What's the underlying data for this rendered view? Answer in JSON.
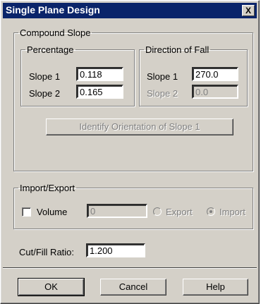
{
  "window": {
    "title": "Single Plane Design",
    "close_glyph": "X"
  },
  "compound_slope": {
    "legend": "Compound Slope",
    "percentage": {
      "legend": "Percentage",
      "slope1_label": "Slope 1",
      "slope1_value": "0.118",
      "slope2_label": "Slope 2",
      "slope2_value": "0.165"
    },
    "direction": {
      "legend": "Direction of Fall",
      "slope1_label": "Slope 1",
      "slope1_value": "270.0",
      "slope2_label": "Slope 2",
      "slope2_value": "0.0"
    },
    "identify_button": "Identify Orientation of Slope 1"
  },
  "import_export": {
    "legend": "Import/Export",
    "volume_label": "Volume",
    "volume_value": "0",
    "volume_checked": false,
    "export_label": "Export",
    "import_label": "Import",
    "selected": "Import"
  },
  "cut_fill": {
    "label": "Cut/Fill Ratio:",
    "value": "1.200"
  },
  "buttons": {
    "ok": "OK",
    "cancel": "Cancel",
    "help": "Help"
  },
  "colors": {
    "face": "#d4d0c8",
    "titlebar": "#0a246a",
    "disabled_text": "#808080"
  }
}
